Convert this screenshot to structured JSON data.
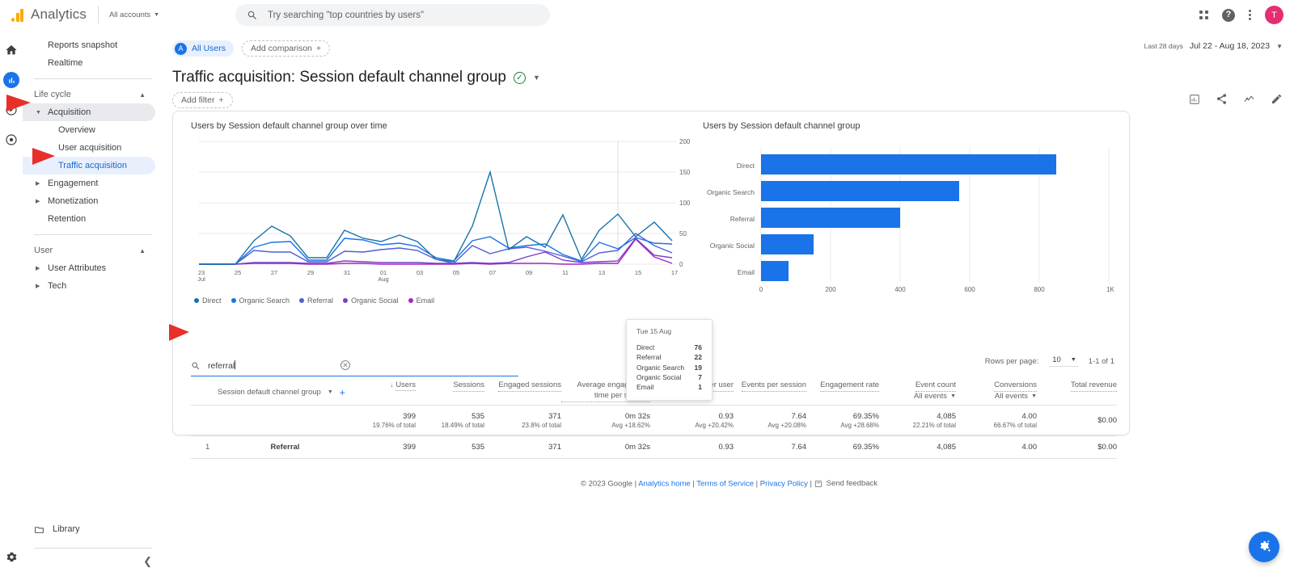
{
  "topbar": {
    "brand": "Analytics",
    "account_label": "All accounts",
    "search_placeholder": "Try searching \"top countries by users\"",
    "apps_icon": "grid-apps-icon",
    "help_icon": "help-icon",
    "more_icon": "kebab-more-icon",
    "avatar_initial": "T"
  },
  "rail": {
    "home_icon": "home-icon",
    "reports_icon": "reports-bar-chart-icon",
    "explore_icon": "explore-compass-icon",
    "advertising_icon": "advertising-target-icon",
    "settings_icon": "gear-icon"
  },
  "sidebar": {
    "items": [
      {
        "label": "Reports snapshot",
        "type": "item"
      },
      {
        "label": "Realtime",
        "type": "item"
      },
      {
        "label": "Life cycle",
        "type": "group"
      },
      {
        "label": "Acquisition",
        "type": "expandable",
        "state": "selected-grey"
      },
      {
        "label": "Overview",
        "type": "sub"
      },
      {
        "label": "User acquisition",
        "type": "sub"
      },
      {
        "label": "Traffic acquisition",
        "type": "sub",
        "state": "selected-blue"
      },
      {
        "label": "Engagement",
        "type": "expandable"
      },
      {
        "label": "Monetization",
        "type": "expandable"
      },
      {
        "label": "Retention",
        "type": "item"
      },
      {
        "label": "User",
        "type": "group"
      },
      {
        "label": "User Attributes",
        "type": "expandable"
      },
      {
        "label": "Tech",
        "type": "expandable"
      }
    ],
    "library_label": "Library",
    "library_icon": "folder-icon",
    "collapse_icon": "chevron-left-icon"
  },
  "header": {
    "all_users_chip": "All Users",
    "all_users_initial": "A",
    "add_comparison": "Add comparison",
    "date_label": "Last 28 days",
    "date_range": "Jul 22 - Aug 18, 2023",
    "page_title": "Traffic acquisition: Session default channel group",
    "add_filter": "Add filter",
    "toolbar_icons": [
      "insights-chart-icon",
      "share-icon",
      "compare-trend-icon",
      "edit-pencil-icon"
    ]
  },
  "chart_data": [
    {
      "type": "line",
      "title": "Users by Session default channel group over time",
      "xlabel": "",
      "ylabel": "",
      "ylim": [
        0,
        200
      ],
      "yticks": [
        0,
        50,
        100,
        150,
        200
      ],
      "grid": true,
      "legend_position": "bottom",
      "x": [
        "23 Jul",
        "24",
        "25",
        "26",
        "27",
        "28",
        "29",
        "30",
        "31",
        "01 Aug",
        "02",
        "03",
        "04",
        "05",
        "06",
        "07",
        "08",
        "09",
        "10",
        "11",
        "12",
        "13",
        "14",
        "15",
        "16",
        "17",
        "18"
      ],
      "xtick_labels": [
        "23\nJul",
        "25",
        "27",
        "29",
        "31",
        "01\nAug",
        "03",
        "05",
        "07",
        "09",
        "11",
        "13",
        "15",
        "17"
      ],
      "series": [
        {
          "name": "Direct",
          "color": "#1a73a8",
          "values": [
            1,
            1,
            1,
            38,
            62,
            46,
            10,
            11,
            55,
            42,
            37,
            47,
            37,
            8,
            4,
            62,
            150,
            23,
            45,
            28,
            80,
            8,
            55,
            82,
            45,
            68,
            38
          ]
        },
        {
          "name": "Organic Search",
          "color": "#1a73e8",
          "values": [
            1,
            1,
            1,
            28,
            35,
            37,
            6,
            6,
            42,
            40,
            31,
            34,
            29,
            10,
            5,
            38,
            45,
            26,
            30,
            33,
            16,
            5,
            36,
            25,
            44,
            34,
            32
          ]
        },
        {
          "name": "Referral",
          "color": "#4f5fd7",
          "values": [
            1,
            1,
            1,
            22,
            19,
            20,
            4,
            4,
            21,
            19,
            24,
            26,
            22,
            8,
            4,
            30,
            17,
            25,
            28,
            21,
            13,
            4,
            18,
            22,
            50,
            30,
            18
          ]
        },
        {
          "name": "Organic Social",
          "color": "#7b3fc9",
          "values": [
            1,
            1,
            1,
            3,
            3,
            2,
            1,
            1,
            5,
            4,
            2,
            2,
            2,
            1,
            1,
            3,
            2,
            3,
            12,
            20,
            7,
            2,
            4,
            5,
            42,
            14,
            10
          ]
        },
        {
          "name": "Email",
          "color": "#a626c7",
          "values": [
            0,
            0,
            0,
            1,
            1,
            1,
            0,
            0,
            1,
            1,
            0,
            0,
            0,
            0,
            0,
            1,
            0,
            1,
            1,
            1,
            0,
            0,
            1,
            1,
            40,
            12,
            1
          ]
        }
      ]
    },
    {
      "type": "bar",
      "orientation": "horizontal",
      "title": "Users by Session default channel group",
      "categories": [
        "Direct",
        "Organic Search",
        "Referral",
        "Organic Social",
        "Email"
      ],
      "values": [
        850,
        570,
        400,
        152,
        78
      ],
      "bar_color": "#1a73e8",
      "xlim": [
        0,
        1000
      ],
      "xticks": [
        "0",
        "200",
        "400",
        "600",
        "800",
        "1K"
      ],
      "grid": true
    }
  ],
  "tooltip": {
    "date": "Tue 15 Aug",
    "rows": [
      {
        "label": "Direct",
        "value": "76"
      },
      {
        "label": "Referral",
        "value": "22"
      },
      {
        "label": "Organic Search",
        "value": "19"
      },
      {
        "label": "Organic Social",
        "value": "7"
      },
      {
        "label": "Email",
        "value": "1"
      }
    ]
  },
  "table": {
    "search_value": "referral",
    "rows_per_page_label": "Rows per page:",
    "rows_per_page_value": "10",
    "pagination": "1-1 of 1",
    "dimension_header": "Session default channel group",
    "columns": [
      {
        "header": "Users",
        "sorted": true
      },
      {
        "header": "Sessions"
      },
      {
        "header": "Engaged sessions"
      },
      {
        "header": "Average engagement time per session"
      },
      {
        "header": "Sessions per user"
      },
      {
        "header": "Events per session"
      },
      {
        "header": "Engagement rate"
      },
      {
        "header": "Event count",
        "sub": "All events"
      },
      {
        "header": "Conversions",
        "sub": "All events"
      },
      {
        "header": "Total revenue"
      }
    ],
    "totals": [
      {
        "value": "399",
        "note": "19.76% of total"
      },
      {
        "value": "535",
        "note": "18.49% of total"
      },
      {
        "value": "371",
        "note": "23.8% of total"
      },
      {
        "value": "0m 32s",
        "note": "Avg +18.62%"
      },
      {
        "value": "0.93",
        "note": "Avg +20.42%"
      },
      {
        "value": "7.64",
        "note": "Avg +20.08%"
      },
      {
        "value": "69.35%",
        "note": "Avg +28.68%"
      },
      {
        "value": "4,085",
        "note": "22.21% of total"
      },
      {
        "value": "4.00",
        "note": "66.67% of total"
      },
      {
        "value": "$0.00",
        "note": ""
      }
    ],
    "rows": [
      {
        "index": "1",
        "name": "Referral",
        "cells": [
          "399",
          "535",
          "371",
          "0m 32s",
          "0.93",
          "7.64",
          "69.35%",
          "4,085",
          "4.00",
          "$0.00"
        ]
      }
    ]
  },
  "footer": {
    "copyright": "© 2023 Google",
    "links": [
      "Analytics home",
      "Terms of Service",
      "Privacy Policy"
    ],
    "feedback": "Send feedback"
  },
  "fab": {
    "icon": "insights-sparkle-icon"
  }
}
